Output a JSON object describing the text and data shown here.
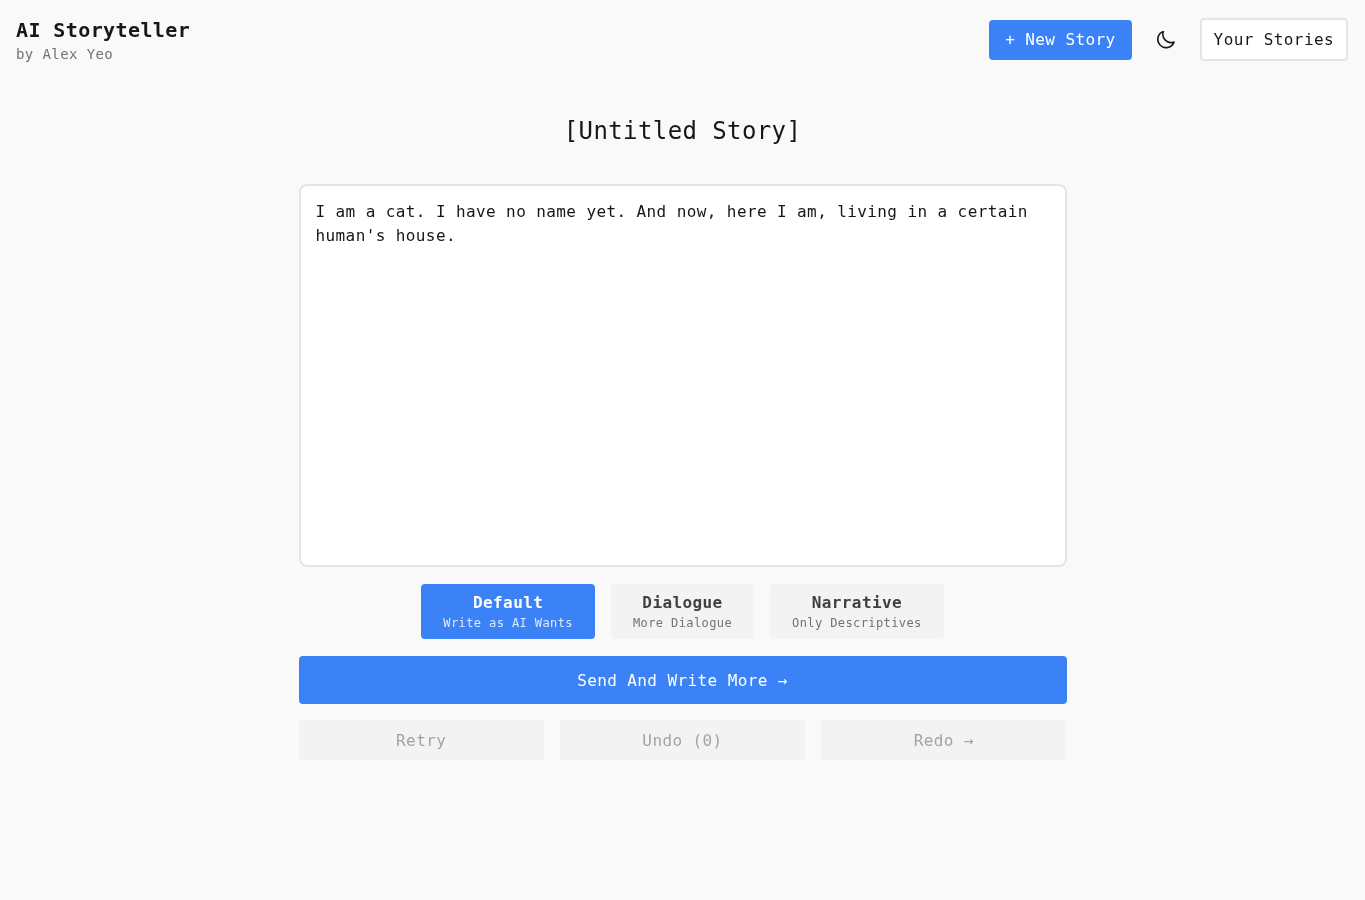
{
  "header": {
    "title": "AI Storyteller",
    "byline": "by Alex Yeo"
  },
  "toolbar": {
    "new_story": "+ New Story",
    "your_stories": "Your Stories"
  },
  "story": {
    "title": "[Untitled Story]",
    "text": "I am a cat. I have no name yet. And now, here I am, living in a certain human's house."
  },
  "modes": [
    {
      "label": "Default",
      "description": "Write as AI Wants",
      "selected": true
    },
    {
      "label": "Dialogue",
      "description": "More Dialogue",
      "selected": false
    },
    {
      "label": "Narrative",
      "description": "Only Descriptives",
      "selected": false
    }
  ],
  "send_button": "Send And Write More →",
  "actions": [
    {
      "label": "Retry",
      "disabled": true
    },
    {
      "label": "Undo (0)",
      "disabled": true
    },
    {
      "label": "Redo →",
      "disabled": true
    }
  ]
}
